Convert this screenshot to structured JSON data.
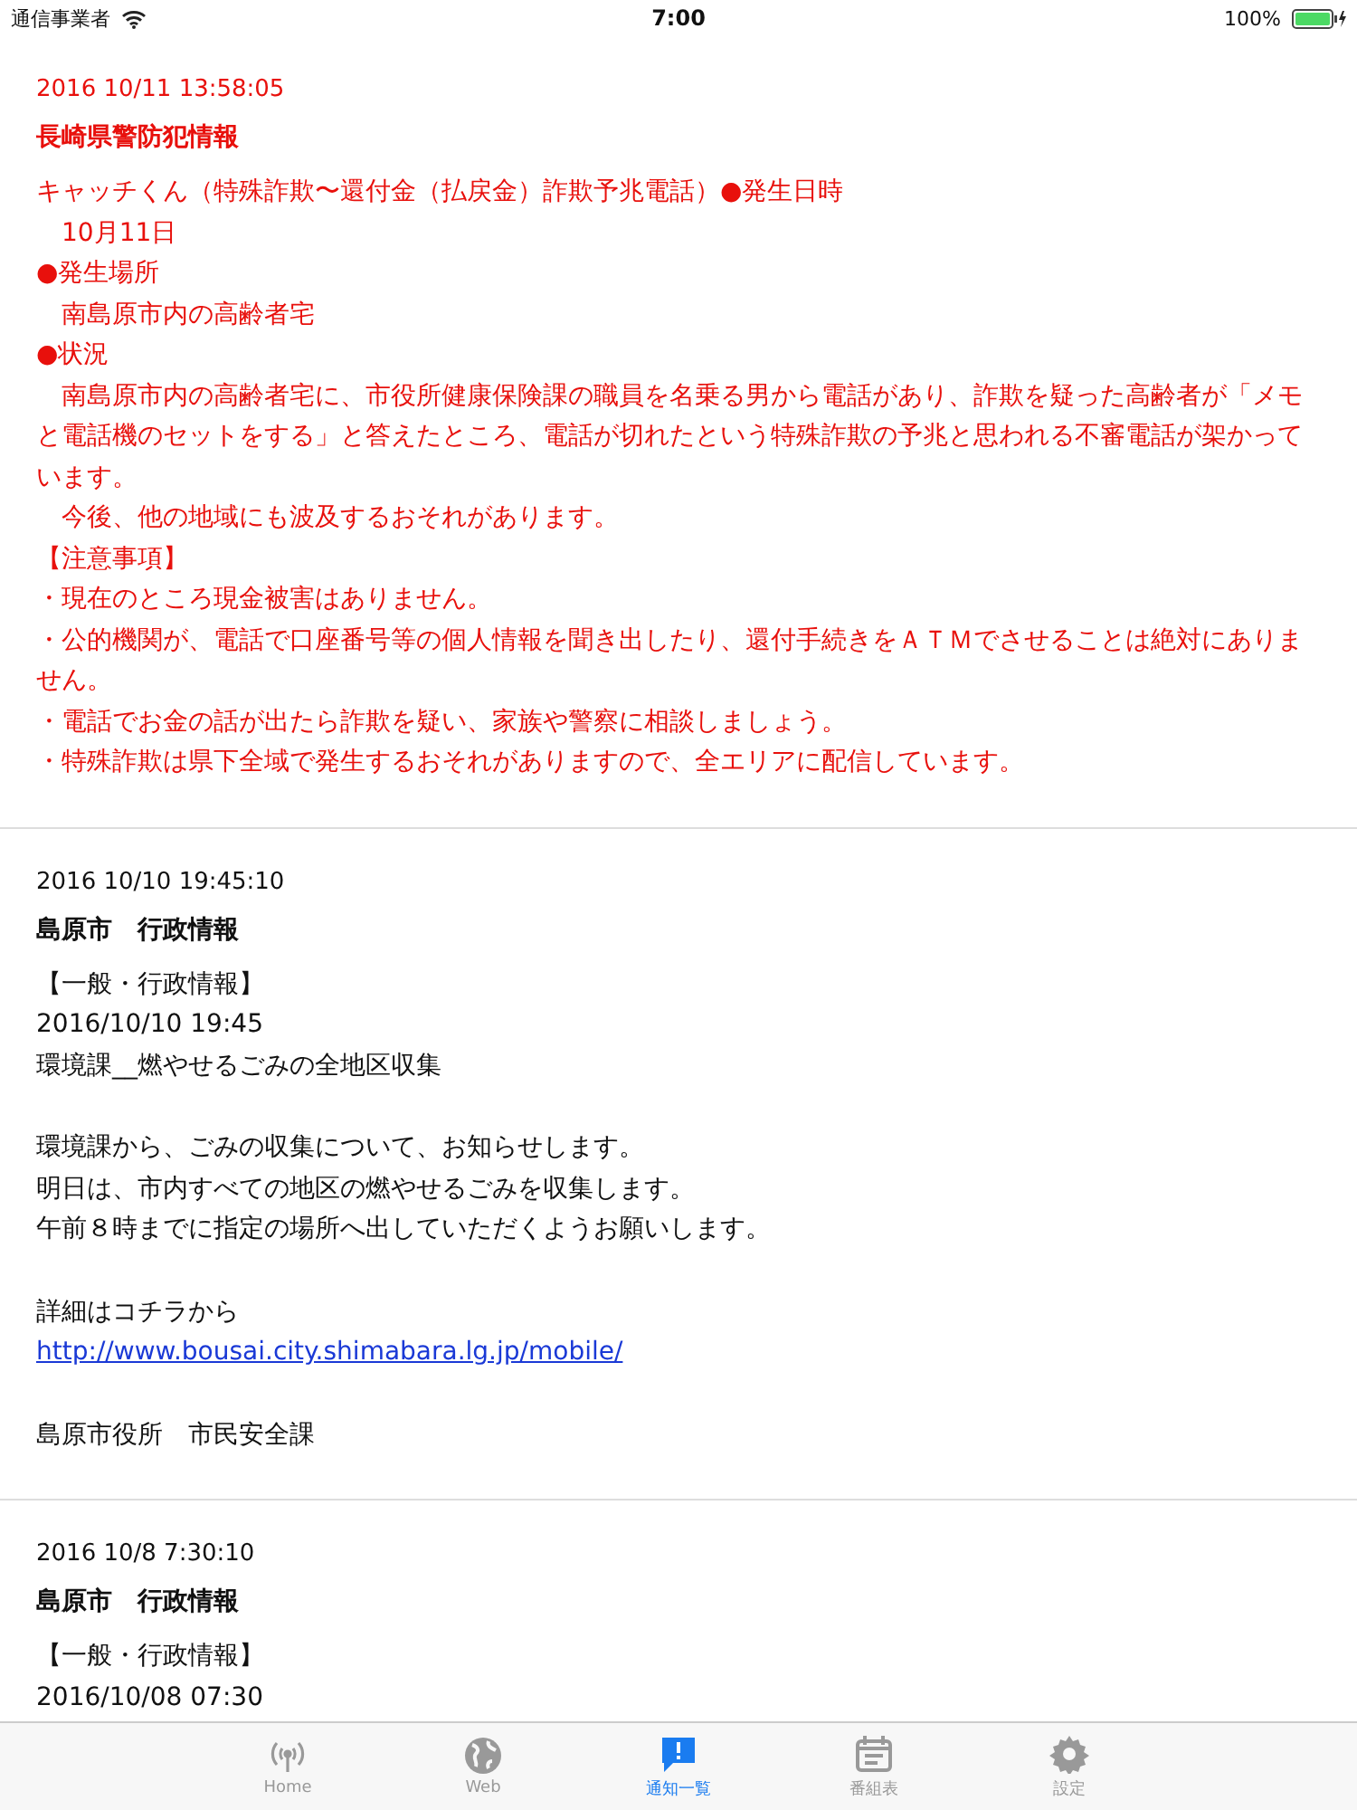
{
  "status_bar": {
    "carrier": "通信事業者",
    "time": "7:00",
    "battery": "100%"
  },
  "messages": [
    {
      "urgent": true,
      "date": "2016 10/11 13:58:05",
      "title": "長崎県警防犯情報",
      "blocks": [
        {
          "lines": [
            {
              "kind": "text",
              "text": "キャッチくん（特殊詐欺〜還付金（払戻金）詐欺予兆電話）●発生日時"
            },
            {
              "kind": "text",
              "text": "　10月11日"
            },
            {
              "kind": "text",
              "text": "●発生場所"
            },
            {
              "kind": "text",
              "text": "　南島原市内の高齢者宅"
            },
            {
              "kind": "text",
              "text": "●状況"
            },
            {
              "kind": "text",
              "text": "　南島原市内の高齢者宅に、市役所健康保険課の職員を名乗る男から電話があり、詐欺を疑った高齢者が「メモと電話機のセットをする」と答えたところ、電話が切れたという特殊詐欺の予兆と思われる不審電話が架かっています。"
            },
            {
              "kind": "text",
              "text": "　今後、他の地域にも波及するおそれがあります。"
            },
            {
              "kind": "text",
              "text": "【注意事項】"
            },
            {
              "kind": "text",
              "text": "・現在のところ現金被害はありません。"
            },
            {
              "kind": "text",
              "text": "・公的機関が、電話で口座番号等の個人情報を聞き出したり、還付手続きをＡＴＭでさせることは絶対にありません。"
            },
            {
              "kind": "text",
              "text": "・電話でお金の話が出たら詐欺を疑い、家族や警察に相談しましょう。"
            },
            {
              "kind": "text",
              "text": "・特殊詐欺は県下全域で発生するおそれがありますので、全エリアに配信しています。"
            }
          ]
        }
      ]
    },
    {
      "urgent": false,
      "date": "2016 10/10 19:45:10",
      "title": "島原市　行政情報",
      "blocks": [
        {
          "lines": [
            {
              "kind": "text",
              "text": "【一般・行政情報】"
            },
            {
              "kind": "text",
              "text": "2016/10/10 19:45"
            },
            {
              "kind": "text",
              "text": "環境課__燃やせるごみの全地区収集"
            }
          ]
        },
        {
          "lines": [
            {
              "kind": "text",
              "text": "環境課から、ごみの収集について、お知らせします。"
            },
            {
              "kind": "text",
              "text": "明日は、市内すべての地区の燃やせるごみを収集します。"
            },
            {
              "kind": "text",
              "text": "午前８時までに指定の場所へ出していただくようお願いします。"
            }
          ]
        },
        {
          "lines": [
            {
              "kind": "text",
              "text": "詳細はコチラから"
            },
            {
              "kind": "link",
              "text": "http://www.bousai.city.shimabara.lg.jp/mobile/"
            }
          ]
        },
        {
          "lines": [
            {
              "kind": "text",
              "text": "島原市役所　市民安全課"
            }
          ]
        }
      ]
    },
    {
      "urgent": false,
      "date": "2016 10/8 7:30:10",
      "title": "島原市　行政情報",
      "blocks": [
        {
          "lines": [
            {
              "kind": "text",
              "text": "【一般・行政情報】"
            },
            {
              "kind": "text",
              "text": "2016/10/08 07:30"
            }
          ]
        }
      ]
    }
  ],
  "tabs": [
    {
      "label": "Home",
      "selected": false
    },
    {
      "label": "Web",
      "selected": false
    },
    {
      "label": "通知一覧",
      "selected": true
    },
    {
      "label": "番組表",
      "selected": false
    },
    {
      "label": "設定",
      "selected": false
    }
  ]
}
